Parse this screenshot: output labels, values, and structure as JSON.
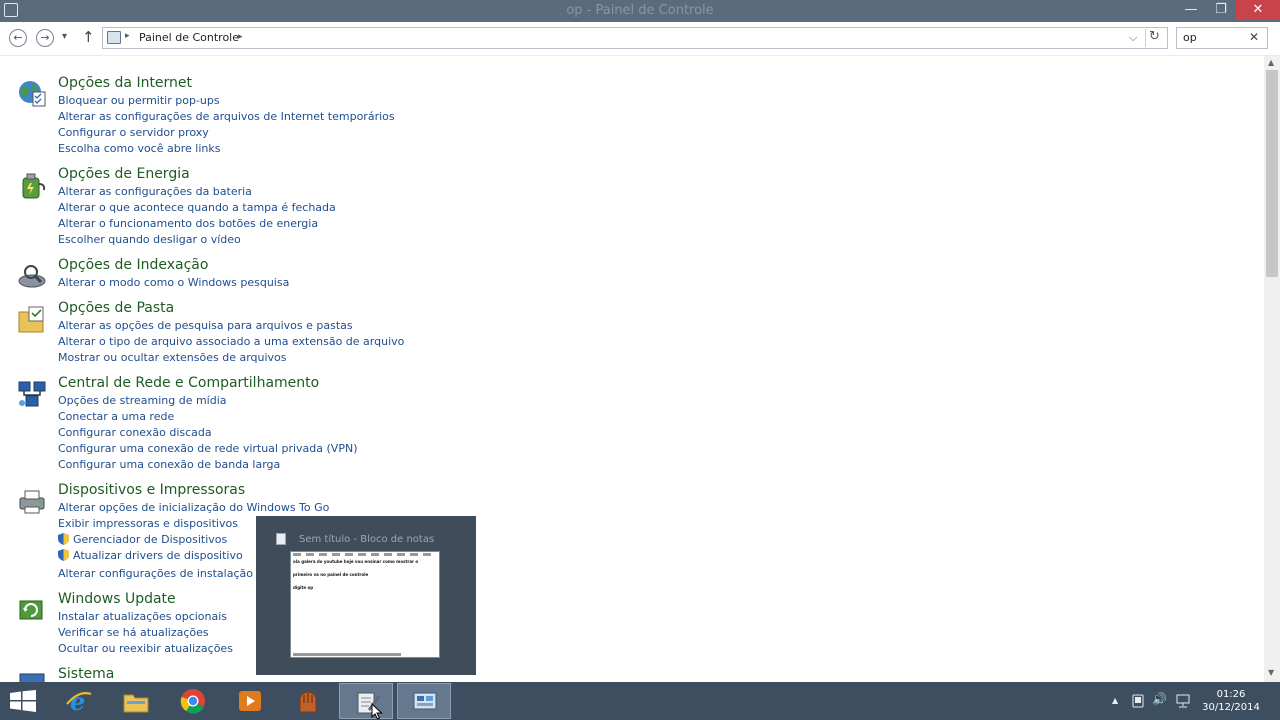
{
  "window": {
    "title": "op - Painel de Controle",
    "minimize": "—",
    "maximize": "❐",
    "close": "✕",
    "accent_titlebar": "#5b6b7d",
    "close_color": "#c7444a"
  },
  "toolbar": {
    "back": "←",
    "forward": "→",
    "recent": "▾",
    "up": "↑",
    "breadcrumb": "Painel de Controle",
    "crumb_sep": "▸",
    "dropdown": "⌵",
    "refresh": "↻",
    "search_value": "op",
    "search_clear": "✕"
  },
  "scroll": {
    "up": "▲",
    "down": "▼"
  },
  "categories": [
    {
      "title": "Opções da Internet",
      "icon": "internet-options-icon",
      "links": [
        "Bloquear ou permitir pop-ups",
        "Alterar as configurações de arquivos de Internet temporários",
        "Configurar o servidor proxy",
        "Escolha como você abre links"
      ]
    },
    {
      "title": "Opções de Energia",
      "icon": "power-options-icon",
      "links": [
        "Alterar as configurações da bateria",
        "Alterar o que acontece quando a tampa é fechada",
        "Alterar o funcionamento dos botões de energia",
        "Escolher quando desligar o vídeo"
      ]
    },
    {
      "title": "Opções de Indexação",
      "icon": "indexing-options-icon",
      "links": [
        "Alterar o modo como o Windows pesquisa"
      ]
    },
    {
      "title": "Opções de Pasta",
      "icon": "folder-options-icon",
      "links": [
        "Alterar as opções de pesquisa para arquivos e pastas",
        "Alterar o tipo de arquivo associado a uma extensão de arquivo",
        "Mostrar ou ocultar extensões de arquivos"
      ]
    },
    {
      "title": "Central de Rede e Compartilhamento",
      "icon": "network-center-icon",
      "links": [
        "Opções de streaming de mídia",
        "Conectar a uma rede",
        "Configurar conexão discada",
        "Configurar uma conexão de rede virtual privada (VPN)",
        "Configurar uma conexão de banda larga"
      ]
    },
    {
      "title": "Dispositivos e Impressoras",
      "icon": "printer-icon",
      "links": [
        "Alterar opções de inicialização do Windows To Go",
        "Exibir impressoras e dispositivos",
        "Gerenciador de Dispositivos",
        "Atualizar drivers de dispositivo",
        "Alterar configurações de instalação do d"
      ]
    },
    {
      "title": "Windows Update",
      "icon": "windows-update-icon",
      "links": [
        "Instalar atualizações opcionais",
        "Verificar se há atualizações",
        "Ocultar ou reexibir atualizações"
      ]
    },
    {
      "title": "Sistema",
      "icon": "system-icon",
      "links": []
    }
  ],
  "thumbnail": {
    "title": "Sem título - Bloco de notas",
    "lines": [
      "ola galera do youtube hoje vou ensinar como mostrar o",
      "primeiro va no painel de controle",
      "digite op"
    ]
  },
  "taskbar": {
    "clock_time": "01:26",
    "clock_date": "30/12/2014",
    "tray_chevron": "▲",
    "tray_volume": "🔊",
    "accent": "#3d4e61"
  }
}
